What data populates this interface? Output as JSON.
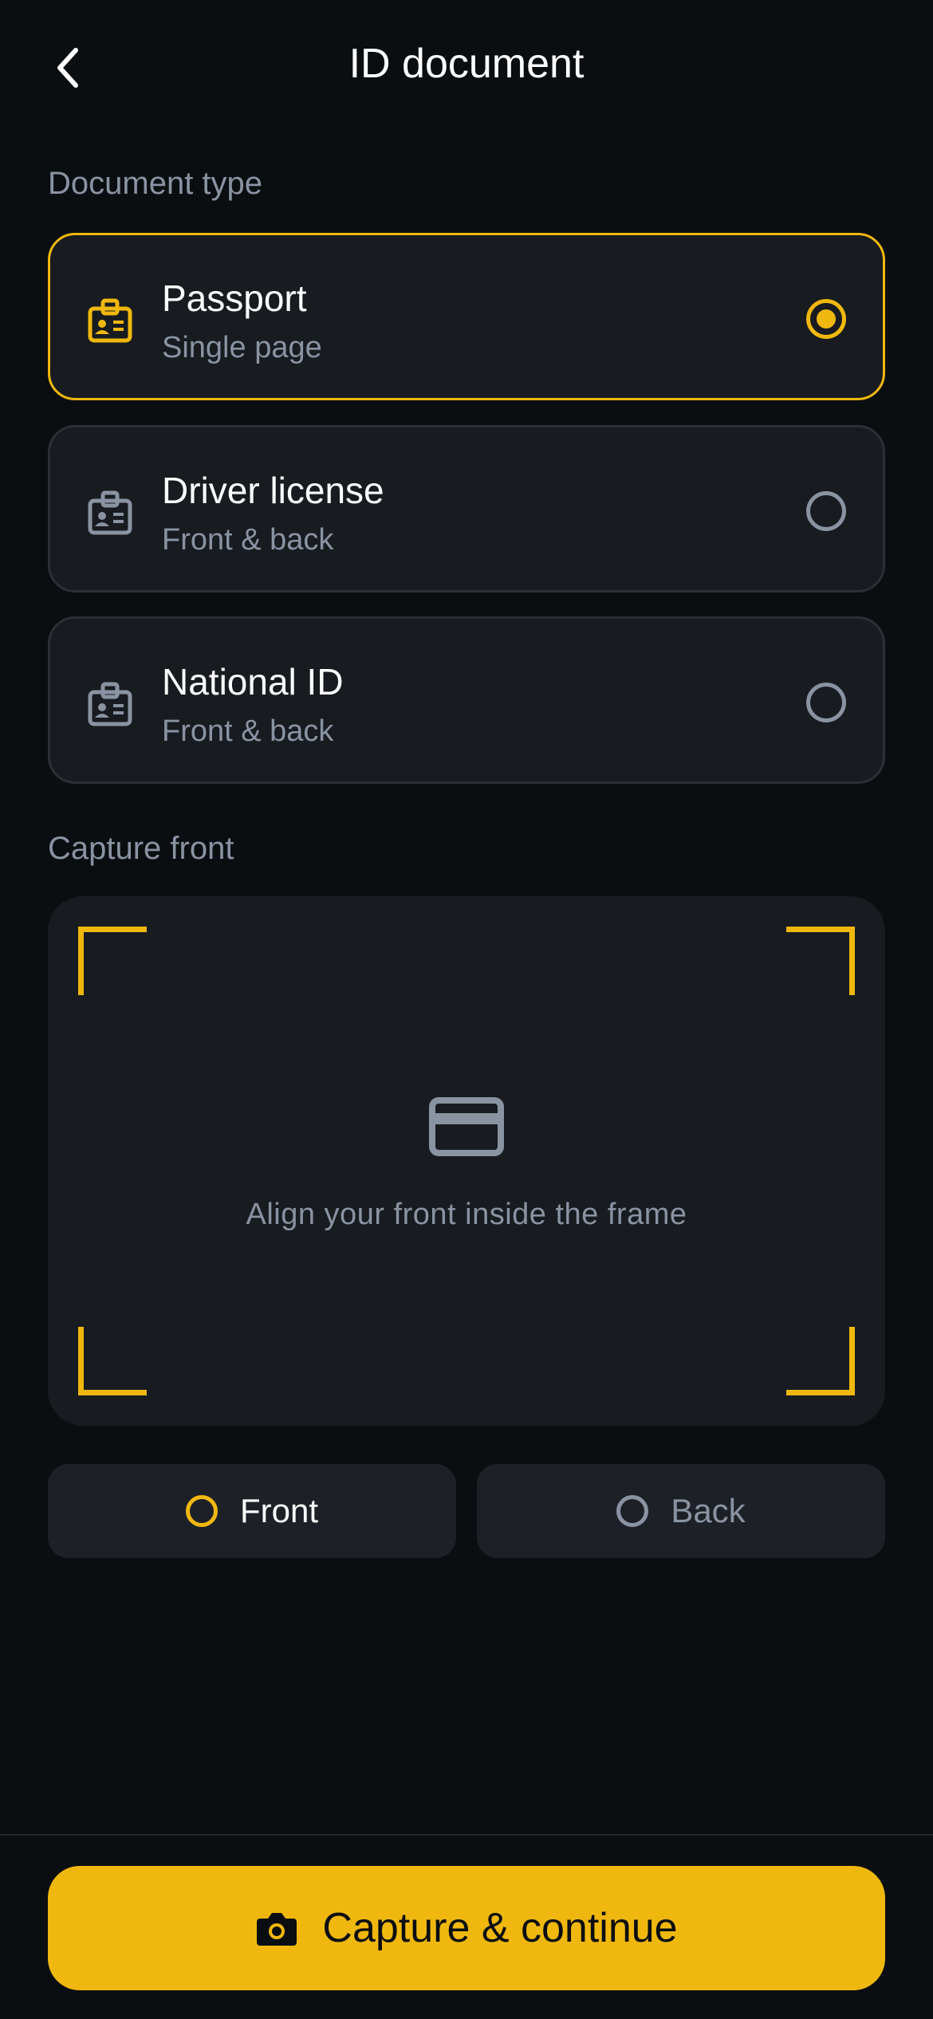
{
  "header": {
    "title": "ID document",
    "back_icon": "chevron-left-icon"
  },
  "document_type": {
    "label": "Document type",
    "options": [
      {
        "title": "Passport",
        "subtitle": "Single page",
        "selected": true,
        "icon": "id-badge-icon"
      },
      {
        "title": "Driver license",
        "subtitle": "Front & back",
        "selected": false,
        "icon": "id-badge-icon"
      },
      {
        "title": "National ID",
        "subtitle": "Front & back",
        "selected": false,
        "icon": "id-badge-icon"
      }
    ]
  },
  "capture": {
    "label": "Capture front",
    "hint": "Align your front inside the frame",
    "icon": "credit-card-icon",
    "sides": [
      {
        "label": "Front",
        "active": true
      },
      {
        "label": "Back",
        "active": false
      }
    ]
  },
  "footer": {
    "primary_label": "Capture & continue",
    "icon": "camera-icon"
  },
  "colors": {
    "background": "#0b0e11",
    "card": "#181b20",
    "accent": "#f0b80e",
    "muted_text": "#8a93a2",
    "border": "#2b2f36"
  }
}
